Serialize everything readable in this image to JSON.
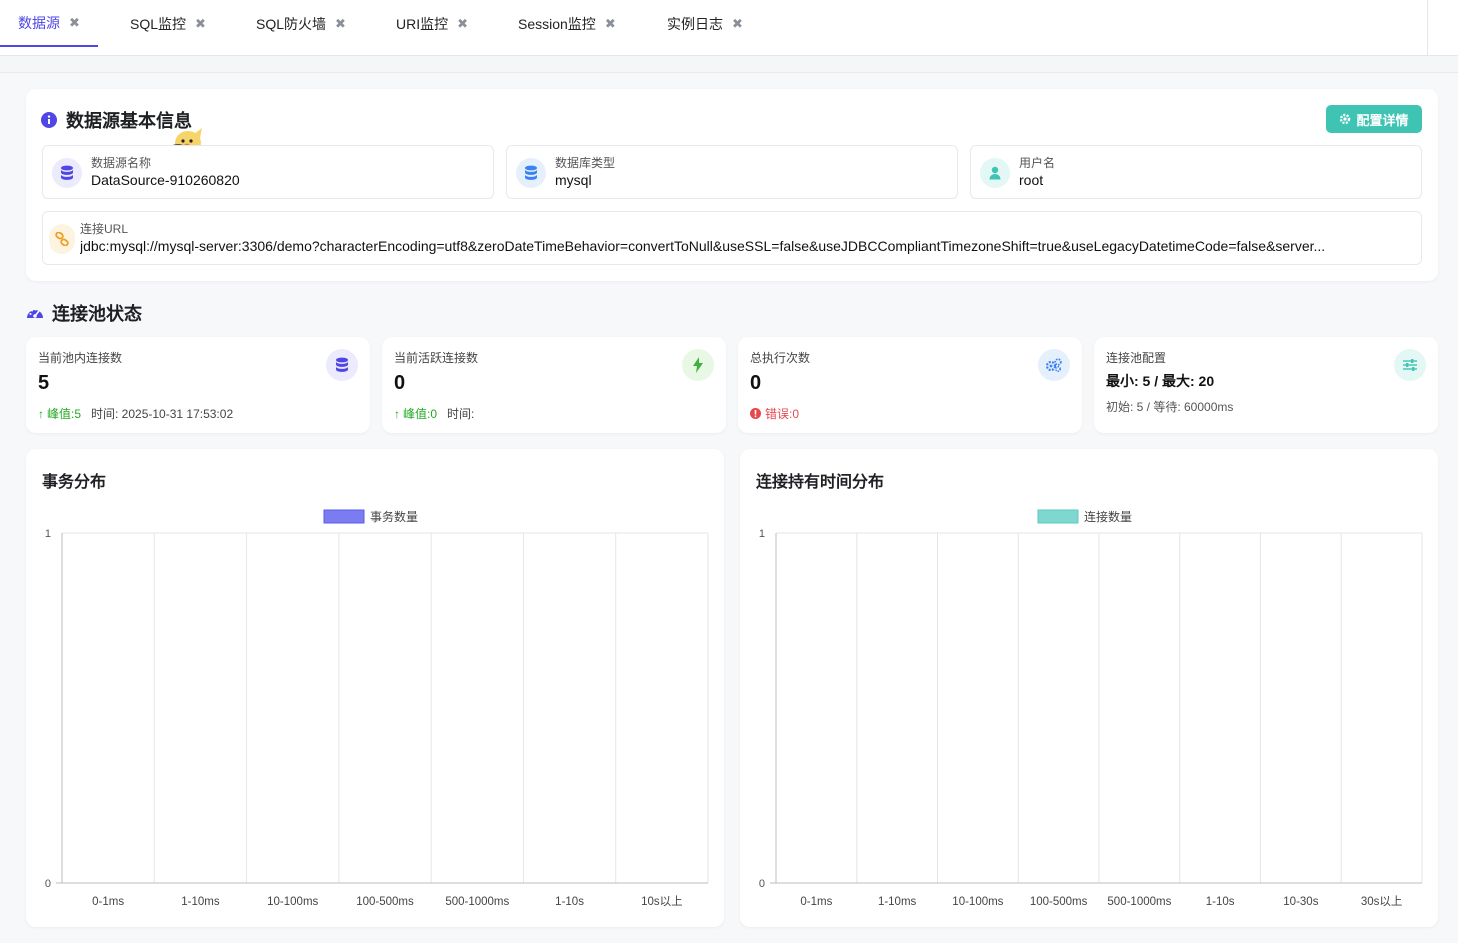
{
  "tabs": [
    {
      "label": "数据源",
      "active": true
    },
    {
      "label": "SQL监控",
      "active": false
    },
    {
      "label": "SQL防火墙",
      "active": false
    },
    {
      "label": "URI监控",
      "active": false
    },
    {
      "label": "Session监控",
      "active": false
    },
    {
      "label": "实例日志",
      "active": false
    }
  ],
  "tab_close_glyph": "✖",
  "basic_info": {
    "title": "数据源基本信息",
    "config_button": "配置详情",
    "fields": {
      "name": {
        "label": "数据源名称",
        "value": "DataSource-910260820",
        "icon": "database-icon"
      },
      "db_type": {
        "label": "数据库类型",
        "value": "mysql",
        "icon": "database-icon"
      },
      "username": {
        "label": "用户名",
        "value": "root",
        "icon": "user-icon"
      }
    },
    "url": {
      "label": "连接URL",
      "value": "jdbc:mysql://mysql-server:3306/demo?characterEncoding=utf8&zeroDateTimeBehavior=convertToNull&useSSL=false&useJDBCCompliantTimezoneShift=true&useLegacyDatetimeCode=false&server...",
      "icon": "link-icon"
    }
  },
  "pool_status": {
    "title": "连接池状态",
    "cards": {
      "current": {
        "label": "当前池内连接数",
        "value": "5",
        "peak": "峰值:5",
        "time": "时间: 2025-10-31 17:53:02"
      },
      "active": {
        "label": "当前活跃连接数",
        "value": "0",
        "peak": "峰值:0",
        "time": "时间:"
      },
      "exec": {
        "label": "总执行次数",
        "value": "0",
        "error": "错误:0"
      },
      "config": {
        "label": "连接池配置",
        "value": "最小: 5 / 最大: 20",
        "detail": "初始: 5 / 等待: 60000ms"
      }
    }
  },
  "colors": {
    "accent": "#4f46e5",
    "teal": "#3fc4b4",
    "green": "#22a922",
    "red": "#e5484d",
    "tx_bar": "#7b7bf2",
    "conn_bar": "#7fd8cf"
  },
  "chart_data": [
    {
      "type": "bar",
      "title": "事务分布",
      "categories": [
        "0-1ms",
        "1-10ms",
        "10-100ms",
        "100-500ms",
        "500-1000ms",
        "1-10s",
        "10s以上"
      ],
      "series": [
        {
          "name": "事务数量",
          "values": [
            0,
            0,
            0,
            0,
            0,
            0,
            0
          ]
        }
      ],
      "ylim": [
        0,
        1
      ],
      "yticks": [
        "0",
        "1"
      ],
      "grid": true,
      "legend": "top-center"
    },
    {
      "type": "bar",
      "title": "连接持有时间分布",
      "categories": [
        "0-1ms",
        "1-10ms",
        "10-100ms",
        "100-500ms",
        "500-1000ms",
        "1-10s",
        "10-30s",
        "30s以上"
      ],
      "series": [
        {
          "name": "连接数量",
          "values": [
            0,
            0,
            0,
            0,
            0,
            0,
            0,
            0
          ]
        }
      ],
      "ylim": [
        0,
        1
      ],
      "yticks": [
        "0",
        "1"
      ],
      "grid": true,
      "legend": "top-center"
    }
  ]
}
